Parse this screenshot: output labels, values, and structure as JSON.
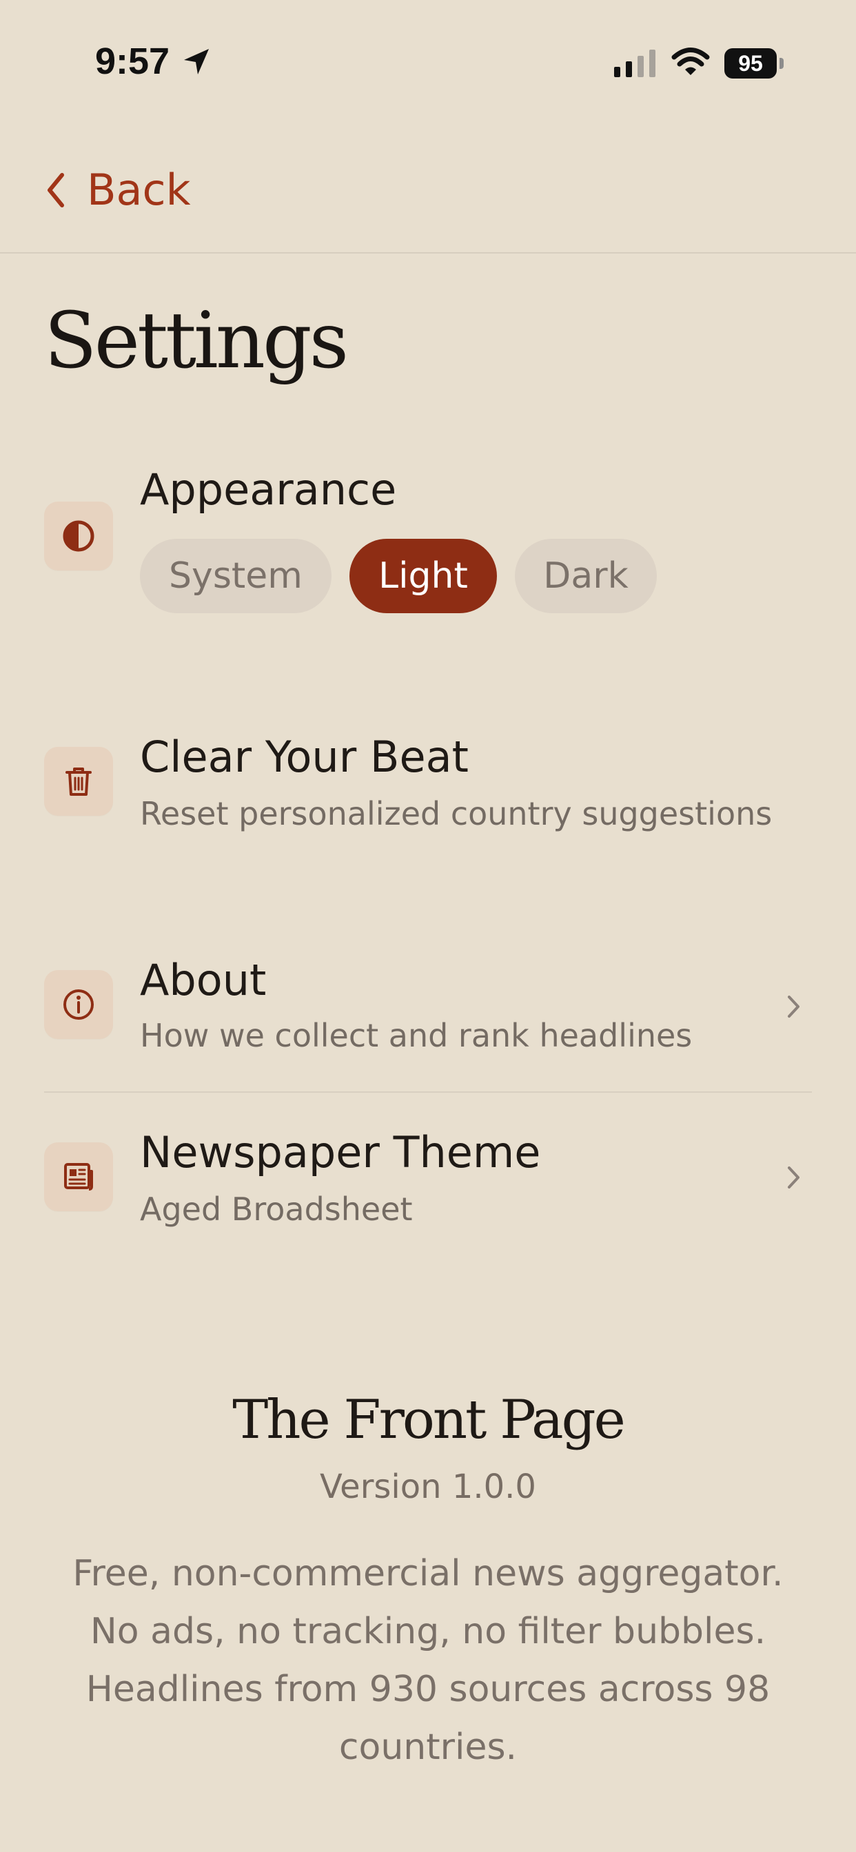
{
  "status_bar": {
    "time": "9:57",
    "battery": "95",
    "icons": [
      "location-icon",
      "signal-icon",
      "wifi-icon",
      "battery-icon"
    ]
  },
  "nav": {
    "back_label": "Back",
    "back_icon": "chevron-left-icon"
  },
  "page": {
    "title": "Settings"
  },
  "settings": {
    "appearance": {
      "title": "Appearance",
      "icon": "contrast-icon",
      "options": [
        "System",
        "Light",
        "Dark"
      ],
      "selected": "Light"
    },
    "clear_beat": {
      "title": "Clear Your Beat",
      "subtitle": "Reset personalized country suggestions",
      "icon": "trash-icon"
    },
    "about": {
      "title": "About",
      "subtitle": "How we collect and rank headlines",
      "icon": "info-icon"
    },
    "newspaper_theme": {
      "title": "Newspaper Theme",
      "subtitle": "Aged Broadsheet",
      "icon": "newspaper-icon"
    }
  },
  "footer": {
    "app_name": "The Front Page",
    "version": "Version 1.0.0",
    "description": "Free, non-commercial news aggregator. No ads, no tracking, no filter bubbles. Headlines from 930 sources across 98 countries."
  },
  "colors": {
    "background": "#e8dfcf",
    "accent": "#a13518",
    "selected_segment": "#8e2d14",
    "icon_bg": "#e7d3c0"
  }
}
